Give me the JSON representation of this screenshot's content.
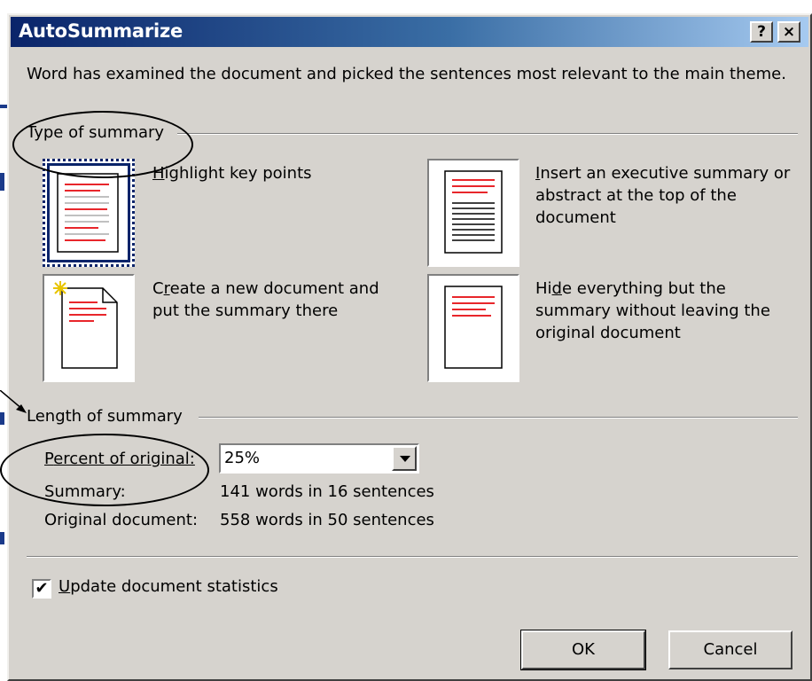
{
  "window": {
    "title": "AutoSummarize",
    "help_glyph": "?",
    "close_glyph": "×"
  },
  "intro_text": "Word has examined the document and picked the sentences most relevant to the main theme.",
  "type_of_summary": {
    "label": "Type of summary",
    "options": [
      {
        "pre": "",
        "mnemonic": "H",
        "post": "ighlight key points",
        "selected": true,
        "icon": "highlight-doc-icon"
      },
      {
        "pre": "",
        "mnemonic": "I",
        "post": "nsert an executive summary or abstract at the top of the document",
        "selected": false,
        "icon": "executive-summary-doc-icon"
      },
      {
        "pre": "C",
        "mnemonic": "r",
        "post": "eate a new document and put the summary there",
        "selected": false,
        "icon": "new-doc-icon"
      },
      {
        "pre": "Hi",
        "mnemonic": "d",
        "post": "e everything but the summary without leaving the original document",
        "selected": false,
        "icon": "hide-doc-icon"
      }
    ]
  },
  "length_of_summary": {
    "label": "Length of summary",
    "percent_label_mnemonic": "P",
    "percent_label_rest": "ercent of original:",
    "percent_value": "25%",
    "summary_label": "Summary:",
    "summary_value": "141 words in 16 sentences",
    "original_label": "Original document:",
    "original_value": "558 words in 50 sentences"
  },
  "update_stats": {
    "checked": true,
    "check_glyph": "✔",
    "label_mnemonic": "U",
    "label_rest": "pdate document statistics"
  },
  "buttons": {
    "ok": "OK",
    "cancel": "Cancel"
  },
  "colors": {
    "title_start": "#0a246a",
    "title_end": "#a6caf0",
    "dialog_face": "#d6d3ce",
    "highlight_red": "#e8262b"
  }
}
